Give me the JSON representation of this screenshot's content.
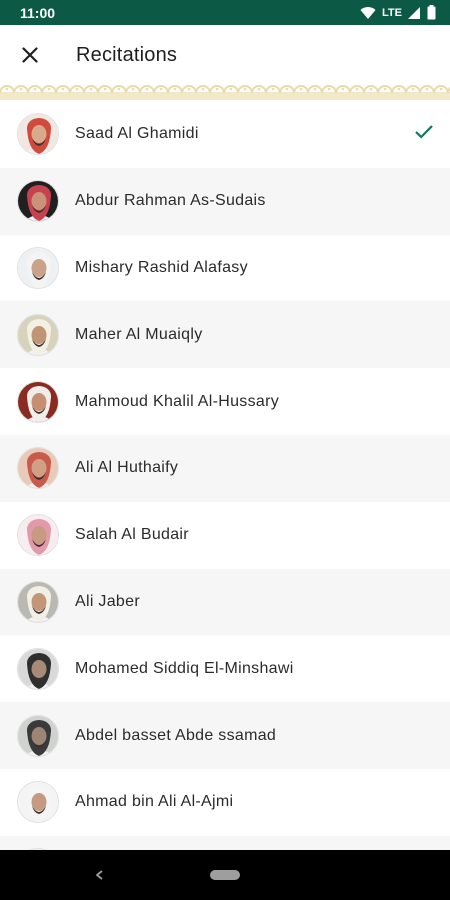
{
  "status_bar": {
    "time": "11:00",
    "network_label": "LTE",
    "icons": [
      "wifi-icon",
      "signal-icon",
      "battery-icon"
    ]
  },
  "app_bar": {
    "title": "Recitations",
    "close_icon": "close-icon"
  },
  "colors": {
    "status_bar": "#0c5a46",
    "accent": "#0c7a5e",
    "ornament": "#e9d9a8",
    "row_alt": "#f6f6f6"
  },
  "reciters": [
    {
      "name": "Saad Al Ghamidi",
      "selected": true,
      "avatar": {
        "skin": "#d9a98c",
        "head": "#d04b3e",
        "bg": "#f1e8e3"
      }
    },
    {
      "name": "Abdur Rahman As-Sudais",
      "selected": false,
      "avatar": {
        "skin": "#c99379",
        "head": "#c8414f",
        "bg": "#202020"
      }
    },
    {
      "name": "Mishary Rashid Alafasy",
      "selected": false,
      "avatar": {
        "skin": "#caa28a",
        "head": "#f4f4f4",
        "bg": "#eef1f4"
      }
    },
    {
      "name": "Maher Al Muaiqly",
      "selected": false,
      "avatar": {
        "skin": "#bf9574",
        "head": "#f3efe2",
        "bg": "#d7d2bb"
      }
    },
    {
      "name": "Mahmoud Khalil Al-Hussary",
      "selected": false,
      "avatar": {
        "skin": "#c88e72",
        "head": "#f1eee9",
        "bg": "#8a2b22"
      }
    },
    {
      "name": "Ali Al Huthaify",
      "selected": false,
      "avatar": {
        "skin": "#d0a085",
        "head": "#c95b4c",
        "bg": "#e9c9b8"
      }
    },
    {
      "name": "Salah Al Budair",
      "selected": false,
      "avatar": {
        "skin": "#c79a82",
        "head": "#e39aa8",
        "bg": "#f7ecef"
      }
    },
    {
      "name": "Ali Jaber",
      "selected": false,
      "avatar": {
        "skin": "#c29677",
        "head": "#f2efe7",
        "bg": "#b7b9b2"
      }
    },
    {
      "name": "Mohamed Siddiq El-Minshawi",
      "selected": false,
      "avatar": {
        "skin": "#a78b78",
        "head": "#2f2f2f",
        "bg": "#d9d9d9"
      }
    },
    {
      "name": "Abdel basset Abde ssamad",
      "selected": false,
      "avatar": {
        "skin": "#9c8575",
        "head": "#3a3a3a",
        "bg": "#cfd2cf"
      }
    },
    {
      "name": "Ahmad bin Ali Al-Ajmi",
      "selected": false,
      "avatar": {
        "skin": "#c69a80",
        "head": "#f5f5f5",
        "bg": "#f4f4f4"
      }
    },
    {
      "name": "",
      "selected": false,
      "avatar": {
        "skin": "#b88e77",
        "head": "#9b5d55",
        "bg": "#f0f0f0"
      }
    }
  ],
  "nav_bar": {
    "back_icon": "back-triangle-icon",
    "home_icon": "home-pill-icon"
  }
}
